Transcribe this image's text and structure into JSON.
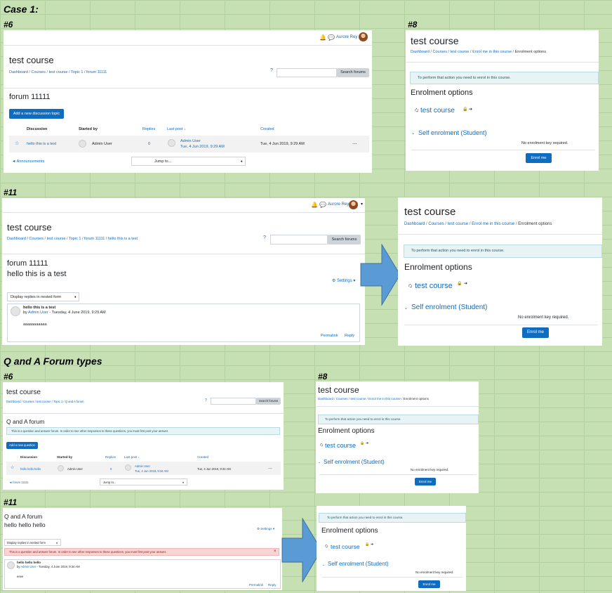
{
  "labels": {
    "case": "Case 1:",
    "n6a": "#6",
    "n8a": "#8",
    "n11a": "#11",
    "qa": "Q and A Forum types",
    "n6b": "#6",
    "n8b": "#8",
    "n11b": "#11"
  },
  "user": "Aurore Rey",
  "bell_icon": "bell-icon",
  "chat_icon": "chat-icon",
  "course_title": "test course",
  "search_button": "Search forums",
  "p6a": {
    "crumbs": [
      "Dashboard",
      "Courses",
      "test course",
      "Topic 1",
      "forum 11111"
    ],
    "forum_title": "forum 11111",
    "add_button": "Add a new discussion topic",
    "columns": [
      "Discussion",
      "Started by",
      "Replies",
      "Last post ↓",
      "Created"
    ],
    "row": {
      "discussion": "hello this is a test",
      "started_by": "Admin User",
      "replies": "0",
      "last_post_user": "Admin User",
      "last_post_date": "Tue, 4 Jun 2019, 9:29 AM",
      "created": "Tue, 4 Jun 2019, 9:29 AM"
    },
    "prev_link": "◄ Announcements",
    "jump": "Jump to..."
  },
  "enrol": {
    "crumbs": [
      "Dashboard",
      "Courses",
      "test course",
      "Enrol me in this course"
    ],
    "crumb_last": "Enrolment options",
    "alert": "To perform that action you need to enrol in this course.",
    "heading": "Enrolment options",
    "course_link": "test course",
    "self": "Self enrolment (Student)",
    "no_key": "No enrolment key required.",
    "button": "Enrol me"
  },
  "p11a": {
    "crumbs": [
      "Dashboard",
      "Courses",
      "test course",
      "Topic 1",
      "forum 11111",
      "hello this is a test"
    ],
    "forum": "forum 11111",
    "discussion": "hello this is a test",
    "settings": "Settings",
    "display": "Display replies in nested form",
    "post_subject": "hello this is a test",
    "post_by": "by",
    "post_author": "Admin User",
    "post_date": " - Tuesday, 4 June 2019, 9:29 AM",
    "post_body": "aaaaaaaaaaa",
    "permalink": "Permalink",
    "reply": "Reply"
  },
  "p6b": {
    "crumbs": [
      "Dashboard",
      "Courses",
      "test course",
      "Topic 1",
      "Q and A forum"
    ],
    "forum_title": "Q and A forum",
    "notice": "This is a question and answer forum. In order to see other responses to these questions, you must first post your answer.",
    "add_button": "Add a new question",
    "columns": [
      "Discussion",
      "Started by",
      "Replies",
      "Last post ↓",
      "Created"
    ],
    "row": {
      "discussion": "hello hello hello",
      "started_by": "Admin User",
      "replies": "0",
      "last_post_user": "Admin User",
      "last_post_date": "Tue, 4 Jun 2019, 9:34 AM",
      "created": "Tue, 4 Jun 2019, 9:34 AM"
    },
    "prev_link": "◄ forum 11111",
    "jump": "Jump to..."
  },
  "p11b": {
    "forum": "Q and A forum",
    "discussion": "hello hello hello",
    "settings": "Settings",
    "display": "Display replies in nested form",
    "notice": "This is a question and answer forum. In order to see other responses to these questions, you must first post your answer.",
    "post_subject": "hello hello hello",
    "post_by": "by",
    "post_author": "Admin User",
    "post_date": " - Tuesday, 4 June 2019, 9:34 AM",
    "post_body": "eeee",
    "permalink": "Permalink",
    "reply": "Reply"
  }
}
